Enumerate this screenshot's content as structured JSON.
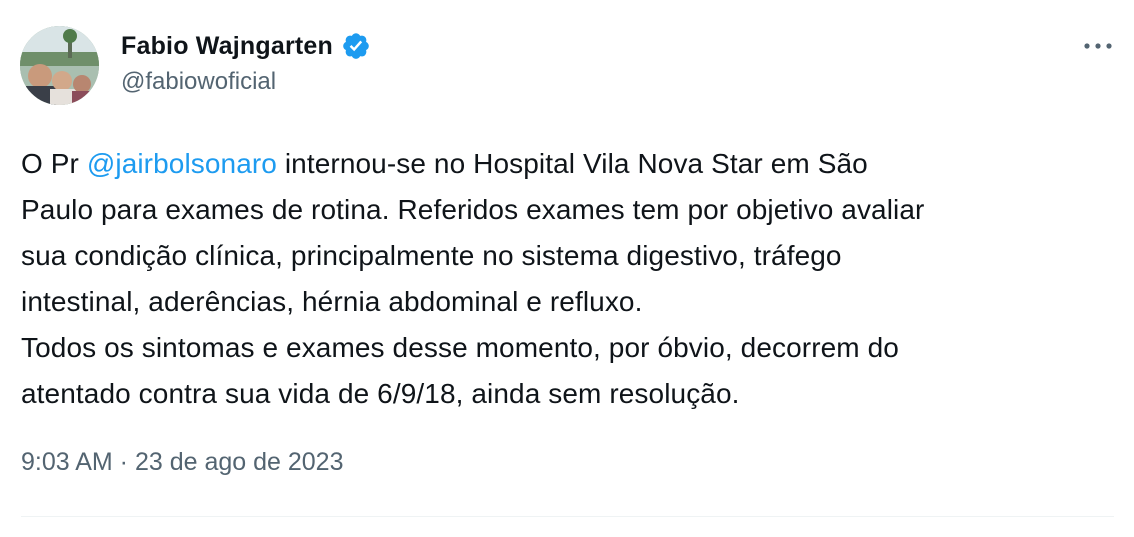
{
  "author": {
    "display_name": "Fabio Wajngarten",
    "handle": "@fabiowoficial",
    "verified": true,
    "verified_color": "#1d9bf0"
  },
  "tweet": {
    "line1_prefix": "O Pr ",
    "mention": "@jairbolsonaro",
    "line1_suffix": " internou-se no Hospital Vila Nova Star em São",
    "line2": "Paulo para exames de rotina. Referidos exames tem por objetivo avaliar",
    "line3": "sua condição clínica, principalmente no sistema digestivo, tráfego",
    "line4": "intestinal, aderências, hérnia abdominal e refluxo.",
    "line5": "Todos os sintomas e exames desse momento, por óbvio, decorrem do",
    "line6": "atentado contra sua vida de 6/9/18, ainda sem resolução."
  },
  "meta": {
    "time": "9:03 AM",
    "separator": " · ",
    "date": "23 de ago de 2023"
  },
  "icons": {
    "verified": "verified-badge-icon",
    "more": "more-horizontal-icon"
  },
  "colors": {
    "text": "#0f1419",
    "secondary": "#536471",
    "link": "#1d9bf0"
  }
}
